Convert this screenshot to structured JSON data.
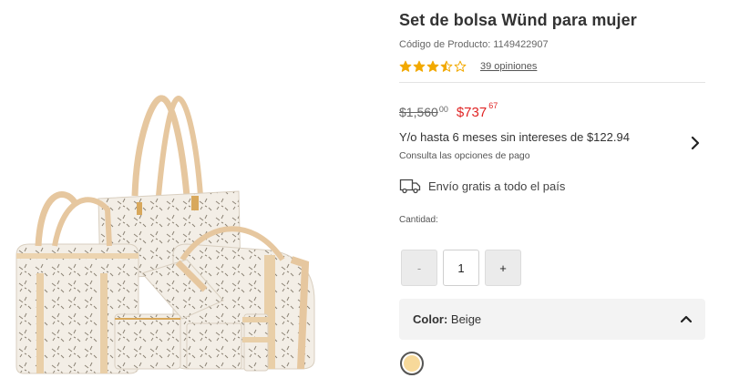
{
  "product": {
    "title": "Set de bolsa Wünd para mujer",
    "code_label": "Código de Producto:",
    "code_value": "1149422907",
    "rating": 3.5,
    "rating_max": 5,
    "reviews_label": "39 opiniones",
    "image_alt_icon": "handbag-set-image"
  },
  "pricing": {
    "old_price": "$1,560",
    "old_cents": "00",
    "new_price": "$737",
    "new_cents": "67",
    "installments_text": "Y/o hasta 6 meses sin intereses de $122.94",
    "installments_sub": "Consulta las opciones de pago",
    "sale_color": "#e02424"
  },
  "shipping": {
    "text": "Envío gratis a todo el país",
    "icon": "truck-icon"
  },
  "quantity": {
    "label": "Cantidad:",
    "minus": "-",
    "value": "1",
    "plus": "+"
  },
  "color": {
    "label": "Color:",
    "value": "Beige",
    "swatch_color": "#f7d99a"
  },
  "colors": {
    "bag_body": "#f1ece4",
    "bag_trim": "#e8c9a0",
    "accent": "#e02424",
    "star": "#f2a900"
  }
}
